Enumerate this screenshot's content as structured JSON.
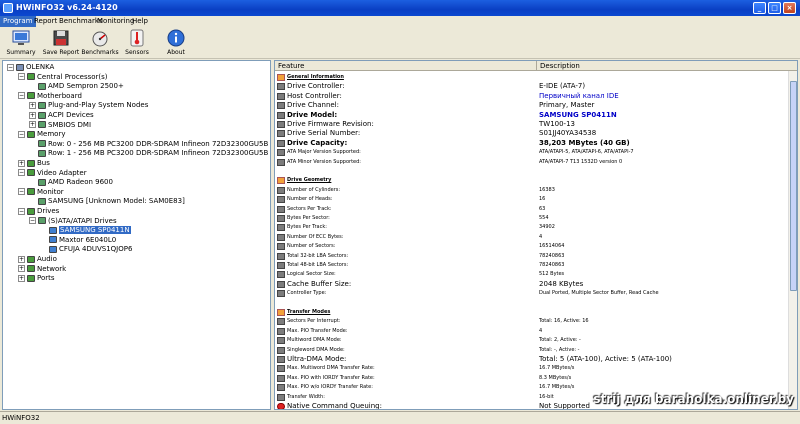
{
  "window": {
    "title": "HWiNFO32 v6.24-4120"
  },
  "menu": [
    {
      "label": "Program",
      "active": true
    },
    {
      "label": "Report"
    },
    {
      "label": "Benchmarks"
    },
    {
      "label": "Monitoring"
    },
    {
      "label": "Help"
    }
  ],
  "toolbar": [
    {
      "label": "Summary",
      "icon": "monitor-icon"
    },
    {
      "label": "Save Report",
      "icon": "floppy-icon"
    },
    {
      "label": "Benchmarks",
      "icon": "gauge-icon"
    },
    {
      "label": "Sensors",
      "icon": "thermometer-icon"
    },
    {
      "label": "About",
      "icon": "info-icon"
    }
  ],
  "tree": [
    {
      "text": "OLENKA",
      "level": 0,
      "exp": "−"
    },
    {
      "text": "Central Processor(s)",
      "level": 1,
      "exp": "−"
    },
    {
      "text": "AMD Sempron 2500+",
      "level": 2
    },
    {
      "text": "Motherboard",
      "level": 1,
      "exp": "−"
    },
    {
      "text": "Plug-and-Play System Nodes",
      "level": 2,
      "exp": "+"
    },
    {
      "text": "ACPI Devices",
      "level": 2,
      "exp": "+"
    },
    {
      "text": "SMBIOS DMI",
      "level": 2,
      "exp": "+"
    },
    {
      "text": "Memory",
      "level": 1,
      "exp": "−"
    },
    {
      "text": "Row: 0 - 256 MB PC3200 DDR-SDRAM Infineon 72D32300GU5B",
      "level": 2
    },
    {
      "text": "Row: 1 - 256 MB PC3200 DDR-SDRAM Infineon 72D32300GU5B",
      "level": 2
    },
    {
      "text": "Bus",
      "level": 1,
      "exp": "+"
    },
    {
      "text": "Video Adapter",
      "level": 1,
      "exp": "−"
    },
    {
      "text": "AMD Radeon 9600",
      "level": 2
    },
    {
      "text": "Monitor",
      "level": 1,
      "exp": "−"
    },
    {
      "text": "SAMSUNG [Unknown Model: SAM0E83]",
      "level": 2
    },
    {
      "text": "Drives",
      "level": 1,
      "exp": "−"
    },
    {
      "text": "(S)ATA/ATAPI Drives",
      "level": 2,
      "exp": "−"
    },
    {
      "text": "SAMSUNG SP0411N",
      "level": 3,
      "selected": true
    },
    {
      "text": "Maxtor 6E040L0",
      "level": 3
    },
    {
      "text": "CFUJA 4DUVS1QJOP6",
      "level": 3
    },
    {
      "text": "Audio",
      "level": 1,
      "exp": "+"
    },
    {
      "text": "Network",
      "level": 1,
      "exp": "+"
    },
    {
      "text": "Ports",
      "level": 1,
      "exp": "+"
    }
  ],
  "columns": {
    "feature": "Feature",
    "description": "Description"
  },
  "rows": [
    {
      "f": "General Information",
      "v": "",
      "type": "sec"
    },
    {
      "f": "Drive Controller:",
      "v": "E-IDE (ATA-7)",
      "type": "big"
    },
    {
      "f": "Host Controller:",
      "v": "Первичный канал IDE",
      "type": "big blue"
    },
    {
      "f": "Drive Channel:",
      "v": "Primary, Master",
      "type": "big"
    },
    {
      "f": "Drive Model:",
      "v": "SAMSUNG SP0411N",
      "type": "big bold blue"
    },
    {
      "f": "Drive Firmware Revision:",
      "v": "TW100-13",
      "type": "big"
    },
    {
      "f": "Drive Serial Number:",
      "v": "S01JJ40YA34538",
      "type": "big"
    },
    {
      "f": "Drive Capacity:",
      "v": "38,203 MBytes (40 GB)",
      "type": "big bold"
    },
    {
      "f": "ATA Major Version Supported:",
      "v": "ATA/ATAPI-5, ATA/ATAPI-6, ATA/ATAPI-7",
      "type": ""
    },
    {
      "f": "ATA Minor Version Supported:",
      "v": "ATA/ATAPI-7 T13 1532D version 0",
      "type": ""
    },
    {
      "f": "",
      "v": "",
      "type": "blank"
    },
    {
      "f": "Drive Geometry",
      "v": "",
      "type": "sec"
    },
    {
      "f": "Number of Cylinders:",
      "v": "16383",
      "type": ""
    },
    {
      "f": "Number of Heads:",
      "v": "16",
      "type": ""
    },
    {
      "f": "Sectors Per Track:",
      "v": "63",
      "type": ""
    },
    {
      "f": "Bytes Per Sector:",
      "v": "554",
      "type": ""
    },
    {
      "f": "Bytes Per Track:",
      "v": "34902",
      "type": ""
    },
    {
      "f": "Number Of ECC Bytes:",
      "v": "4",
      "type": ""
    },
    {
      "f": "Number of Sectors:",
      "v": "16514064",
      "type": ""
    },
    {
      "f": "Total 32-bit LBA Sectors:",
      "v": "78240863",
      "type": ""
    },
    {
      "f": "Total 48-bit LBA Sectors:",
      "v": "78240863",
      "type": ""
    },
    {
      "f": "Logical Sector Size:",
      "v": "512 Bytes",
      "type": ""
    },
    {
      "f": "Cache Buffer Size:",
      "v": "2048 KBytes",
      "type": "big"
    },
    {
      "f": "Controller Type:",
      "v": "Dual Ported, Multiple Sector Buffer, Read Cache",
      "type": ""
    },
    {
      "f": "",
      "v": "",
      "type": "blank"
    },
    {
      "f": "Transfer Modes",
      "v": "",
      "type": "sec"
    },
    {
      "f": "Sectors Per Interrupt:",
      "v": "Total: 16, Active: 16",
      "type": ""
    },
    {
      "f": "Max. PIO Transfer Mode:",
      "v": "4",
      "type": ""
    },
    {
      "f": "Multiword DMA Mode:",
      "v": "Total: 2, Active: -",
      "type": ""
    },
    {
      "f": "Singleword DMA Mode:",
      "v": "Total: -, Active: -",
      "type": ""
    },
    {
      "f": "Ultra-DMA Mode:",
      "v": "Total: 5 (ATA-100), Active: 5 (ATA-100)",
      "type": "big"
    },
    {
      "f": "Max. Multiword DMA Transfer Rate:",
      "v": "16.7 MBytes/s",
      "type": ""
    },
    {
      "f": "Max. PIO with IORDY Transfer Rate:",
      "v": "8.3 MBytes/s",
      "type": ""
    },
    {
      "f": "Max. PIO w/o IORDY Transfer Rate:",
      "v": "16.7 MBytes/s",
      "type": ""
    },
    {
      "f": "Transfer Width:",
      "v": "16-bit",
      "type": ""
    },
    {
      "f": "Native Command Queuing:",
      "v": "Not Supported",
      "type": "big warn"
    }
  ],
  "status": {
    "text": "HWiNFO32"
  },
  "watermark": "strij для baraholka.onliner.by"
}
